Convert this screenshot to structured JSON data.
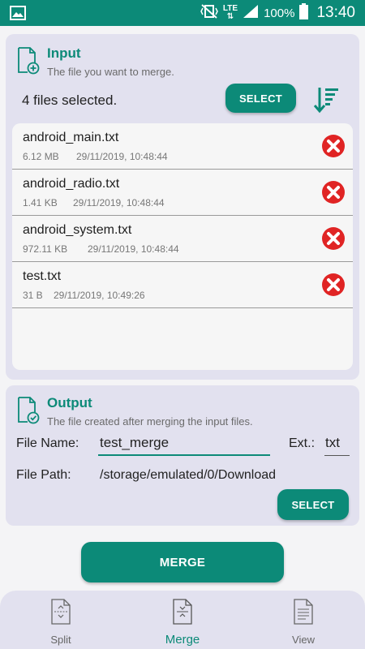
{
  "status_bar": {
    "network": "LTE",
    "battery": "100%",
    "time": "13:40"
  },
  "input": {
    "title": "Input",
    "subtitle": "The file you want to merge.",
    "files_selected": "4 files selected.",
    "select_label": "SELECT",
    "files": [
      {
        "name": "android_main.txt",
        "size": "6.12 MB",
        "date": "29/11/2019, 10:48:44"
      },
      {
        "name": "android_radio.txt",
        "size": "1.41 KB",
        "date": "29/11/2019, 10:48:44"
      },
      {
        "name": "android_system.txt",
        "size": "972.11 KB",
        "date": "29/11/2019, 10:48:44"
      },
      {
        "name": "test.txt",
        "size": "31 B",
        "date": "29/11/2019, 10:49:26"
      }
    ]
  },
  "output": {
    "title": "Output",
    "subtitle": "The file created after merging the input files.",
    "file_name_label": "File Name:",
    "file_name_value": "test_merge",
    "ext_label": "Ext.:",
    "ext_value": "txt",
    "file_path_label": "File Path:",
    "file_path_value": "/storage/emulated/0/Download",
    "select_label": "SELECT"
  },
  "merge_label": "MERGE",
  "nav": [
    {
      "label": "Split",
      "icon": "split-file-icon",
      "active": false
    },
    {
      "label": "Merge",
      "icon": "merge-file-icon",
      "active": true
    },
    {
      "label": "View",
      "icon": "view-file-icon",
      "active": false
    }
  ],
  "colors": {
    "accent": "#0c8a78",
    "card_bg": "#e2e1ef",
    "remove": "#e02424"
  }
}
